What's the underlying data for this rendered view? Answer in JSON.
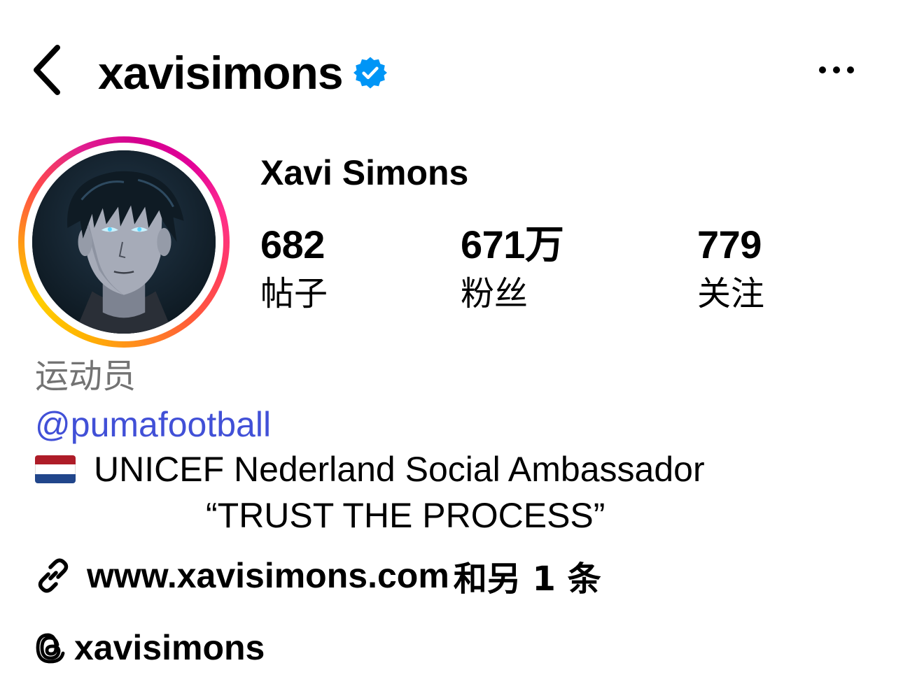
{
  "header": {
    "username": "xavisimons",
    "back_icon": "chevron-left-icon",
    "verified_icon": "verified-badge-icon",
    "more_icon": "more-horizontal-icon"
  },
  "profile": {
    "display_name": "Xavi Simons",
    "stats": {
      "posts": {
        "value": "682",
        "label": "帖子"
      },
      "followers": {
        "value": "671万",
        "label": "粉丝"
      },
      "following": {
        "value": "779",
        "label": "关注"
      }
    }
  },
  "bio": {
    "category": "运动员",
    "mention": "@pumafootball",
    "line1": "UNICEF Nederland Social Ambassador",
    "line2": "“TRUST THE PROCESS”",
    "flag": "netherlands-flag"
  },
  "links": {
    "website": "www.xavisimons.com",
    "more": "和另 1 条",
    "threads_handle": "xavisimons"
  },
  "colors": {
    "mention": "#4150d7",
    "category": "#737373",
    "verified": "#0095f6"
  }
}
